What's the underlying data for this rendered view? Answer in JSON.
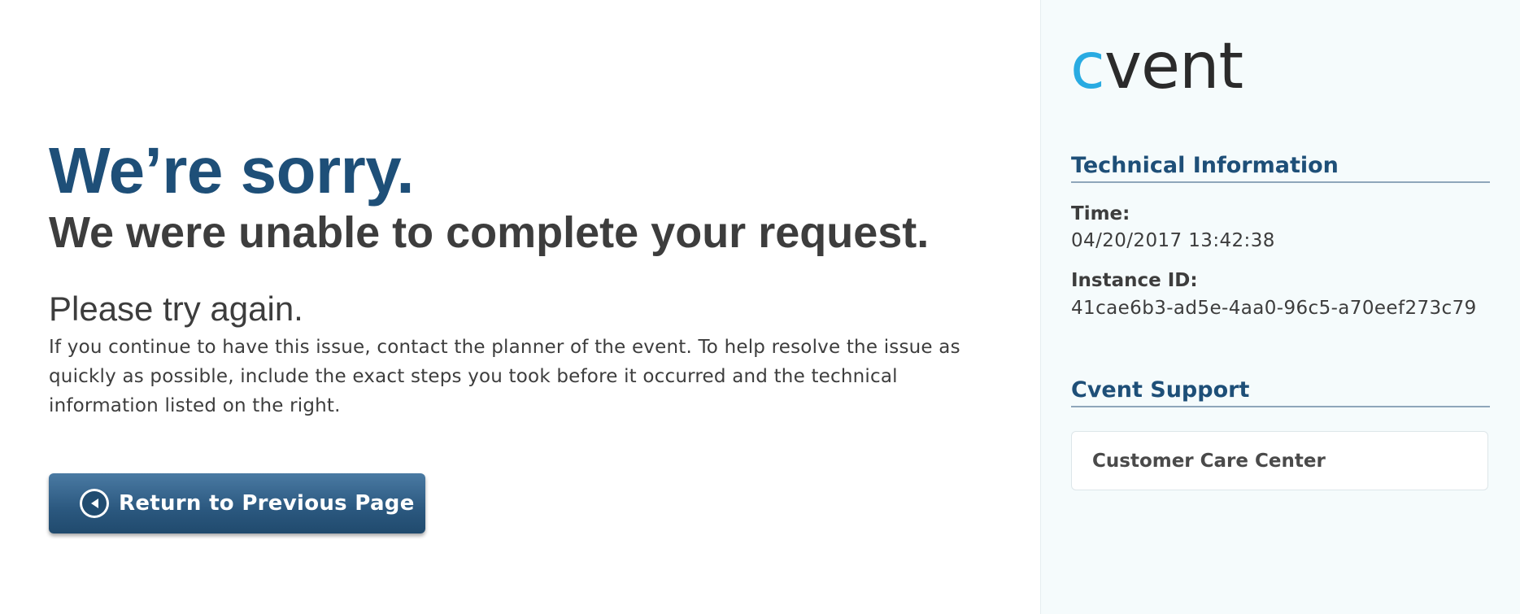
{
  "main": {
    "headline": "We’re sorry.",
    "subheadline": "We were unable to complete your request.",
    "try_again": "Please try again.",
    "body": "If you continue to have this issue, contact the planner of the event. To help resolve the issue as quickly as possible, include the exact steps you took before it occurred and the technical information listed on the right.",
    "return_button_label": "Return to Previous Page",
    "return_button_icon": "chevron-left-icon"
  },
  "sidebar": {
    "logo_text": "cvent",
    "logo_colors": {
      "c": "#29abe2",
      "rest": "#2b2b2b"
    },
    "technical_information": {
      "title": "Technical Information",
      "time_label": "Time:",
      "time_value": "04/20/2017 13:42:38",
      "instance_label": "Instance ID:",
      "instance_value": "41cae6b3-ad5e-4aa0-96c5-a70eef273c79"
    },
    "support": {
      "title": "Cvent Support",
      "link_label": "Customer Care Center"
    }
  },
  "colors": {
    "accent": "#1e4f78",
    "text": "#3d3d3d",
    "sidebar_background": "#f5fbfc"
  }
}
